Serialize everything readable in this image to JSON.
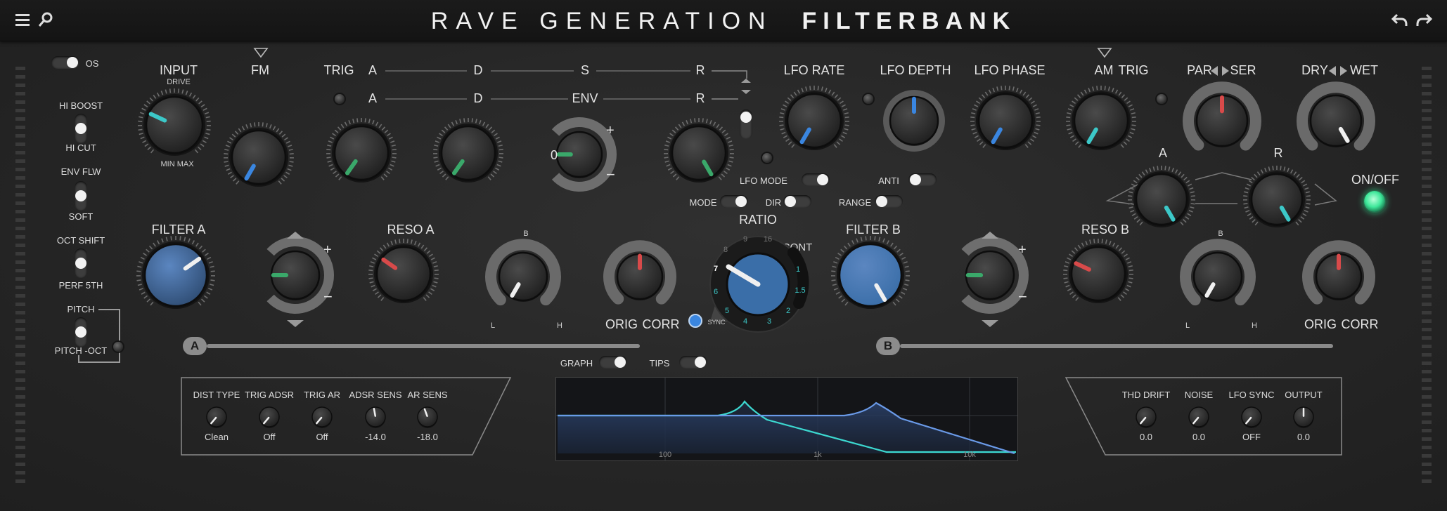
{
  "header": {
    "title_light": "RAVE GENERATION",
    "title_bold": "FILTERBANK"
  },
  "icons": {
    "menu": "hamburger-menu-icon",
    "search": "search-icon",
    "undo": "undo-icon",
    "redo": "redo-icon"
  },
  "colors": {
    "accent_teal": "#3cc8c8",
    "accent_blue": "#3a86e0",
    "accent_green": "#3aa86a",
    "accent_red": "#d84a4a",
    "led_on": "#3ee89a"
  },
  "left": {
    "os_label": "OS",
    "hi_boost": "HI BOOST",
    "hi_cut": "HI CUT",
    "env_flw": "ENV FLW",
    "soft": "SOFT",
    "oct_shift": "OCT SHIFT",
    "perf_5th": "PERF 5TH",
    "pitch": "PITCH",
    "pitch_oct": "PITCH -OCT"
  },
  "top": {
    "input": "INPUT",
    "drive": "DRIVE",
    "min_max": "MIN MAX",
    "fm": "FM",
    "trig": "TRIG",
    "a": "A",
    "d": "D",
    "s": "S",
    "r": "R",
    "env": "ENV",
    "env_value": "0",
    "lfo_rate": "LFO RATE",
    "lfo_depth": "LFO DEPTH",
    "lfo_phase": "LFO PHASE",
    "am": "AM",
    "trig2": "TRIG",
    "par": "PAR",
    "ser": "SER",
    "dry": "DRY",
    "wet": "WET",
    "lfo_mode": "LFO MODE",
    "mode": "MODE",
    "dir": "DIR",
    "anti": "ANTI",
    "range": "RANGE",
    "mix_a": "A",
    "mix_r": "R",
    "on_off": "ON/OFF"
  },
  "mid": {
    "filter_a": "FILTER A",
    "reso_a": "RESO A",
    "filter_b": "FILTER B",
    "reso_b": "RESO B",
    "orig": "ORIG",
    "corr": "CORR",
    "ratio": "RATIO",
    "cont": "CONT",
    "sync": "SYNC",
    "ratio_numbers": [
      "9",
      "16",
      "8",
      "7",
      "6",
      "5",
      "4",
      "3",
      "2",
      "1",
      "1.5",
      "1"
    ],
    "b_small": "B",
    "l_small": "L",
    "h_small": "H",
    "bar_a": "A",
    "bar_b": "B"
  },
  "bottom": {
    "graph_toggle": "GRAPH",
    "tips_toggle": "TIPS",
    "left_params": [
      {
        "label": "DIST TYPE",
        "value": "Clean"
      },
      {
        "label": "TRIG ADSR",
        "value": "Off"
      },
      {
        "label": "TRIG AR",
        "value": "Off"
      },
      {
        "label": "ADSR SENS",
        "value": "-14.0"
      },
      {
        "label": "AR SENS",
        "value": "-18.0"
      }
    ],
    "right_params": [
      {
        "label": "THD DRIFT",
        "value": "0.0"
      },
      {
        "label": "NOISE",
        "value": "0.0"
      },
      {
        "label": "LFO SYNC",
        "value": "OFF"
      },
      {
        "label": "OUTPUT",
        "value": "0.0"
      }
    ],
    "graph_ticks": [
      "100",
      "1k",
      "10k"
    ]
  }
}
